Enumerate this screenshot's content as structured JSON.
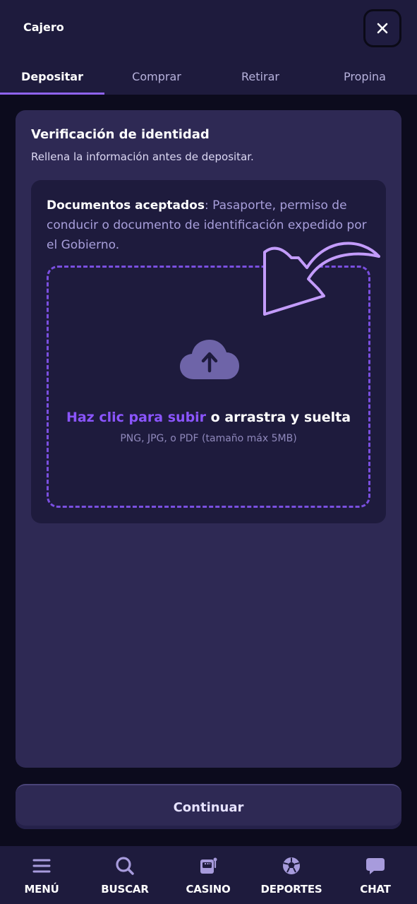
{
  "header": {
    "title": "Cajero",
    "close_icon": "close-icon"
  },
  "tabs": [
    {
      "label": "Depositar",
      "active": true
    },
    {
      "label": "Comprar",
      "active": false
    },
    {
      "label": "Retirar",
      "active": false
    },
    {
      "label": "Propina",
      "active": false
    }
  ],
  "verification": {
    "title": "Verificación de identidad",
    "subtitle": "Rellena la información antes de depositar.",
    "docs_label": "Documentos aceptados",
    "docs_text": ": Pasaporte, permiso de conducir o documento de identificación expedido por el Gobierno.",
    "upload": {
      "icon": "cloud-upload-icon",
      "link_text": "Haz clic para subir",
      "rest_text": " o arrastra y suelta",
      "hint": "PNG, JPG, o PDF (tamaño máx 5MB)"
    }
  },
  "continue_button": "Continuar",
  "bottom_nav": [
    {
      "label": "MENÚ",
      "icon": "menu-icon"
    },
    {
      "label": "BUSCAR",
      "icon": "search-icon"
    },
    {
      "label": "CASINO",
      "icon": "slot-machine-icon"
    },
    {
      "label": "DEPORTES",
      "icon": "soccer-ball-icon"
    },
    {
      "label": "CHAT",
      "icon": "chat-icon"
    }
  ],
  "colors": {
    "background": "#0c0b1d",
    "panel": "#1e1b3d",
    "card": "#2e2954",
    "accent": "#8b55ff",
    "muted_text": "#a89fdb"
  }
}
